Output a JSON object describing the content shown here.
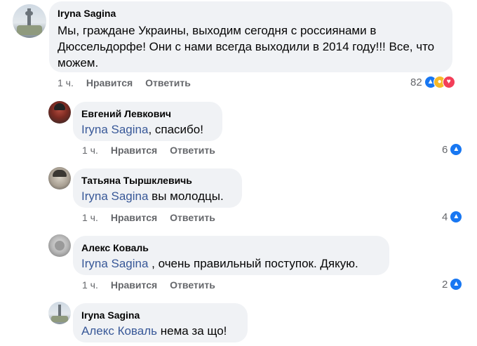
{
  "comments": [
    {
      "author": "Iryna Sagina",
      "mention": "",
      "text": "Мы, граждане Украины, выходим сегодня с россиянами в Дюссельдорфе! Они с нами всегда выходили в 2014 году!!! Все, что можем.",
      "time": "1 ч.",
      "like_label": "Нравится",
      "reply_label": "Ответить",
      "reaction_count": "82",
      "reactions": [
        "like-icon",
        "care-icon",
        "love-icon"
      ]
    },
    {
      "author": "Евгений Левкович",
      "mention": "Iryna Sagina",
      "text": ", спасибо!",
      "time": "1 ч.",
      "like_label": "Нравится",
      "reply_label": "Ответить",
      "reaction_count": "6",
      "reactions": [
        "like-icon"
      ]
    },
    {
      "author": "Татьяна Тыршклевичь",
      "mention": "Iryna Sagina",
      "text": " вы молодцы.",
      "time": "1 ч.",
      "like_label": "Нравится",
      "reply_label": "Ответить",
      "reaction_count": "4",
      "reactions": [
        "like-icon"
      ]
    },
    {
      "author": "Алекс Коваль",
      "mention": "Iryna Sagina",
      "text": " , очень правильный поступок. Дякую.",
      "time": "1 ч.",
      "like_label": "Нравится",
      "reply_label": "Ответить",
      "reaction_count": "2",
      "reactions": [
        "like-icon"
      ]
    },
    {
      "author": "Iryna Sagina",
      "mention": "Алекс Коваль",
      "text": " нема за що!",
      "time": "",
      "like_label": "",
      "reply_label": "",
      "reaction_count": "",
      "reactions": []
    }
  ],
  "colors": {
    "bubble": "#f0f2f5",
    "mention": "#385898",
    "meta": "#65676b",
    "like": "#1877f2",
    "love": "#f33e58",
    "care": "#f7b928"
  }
}
